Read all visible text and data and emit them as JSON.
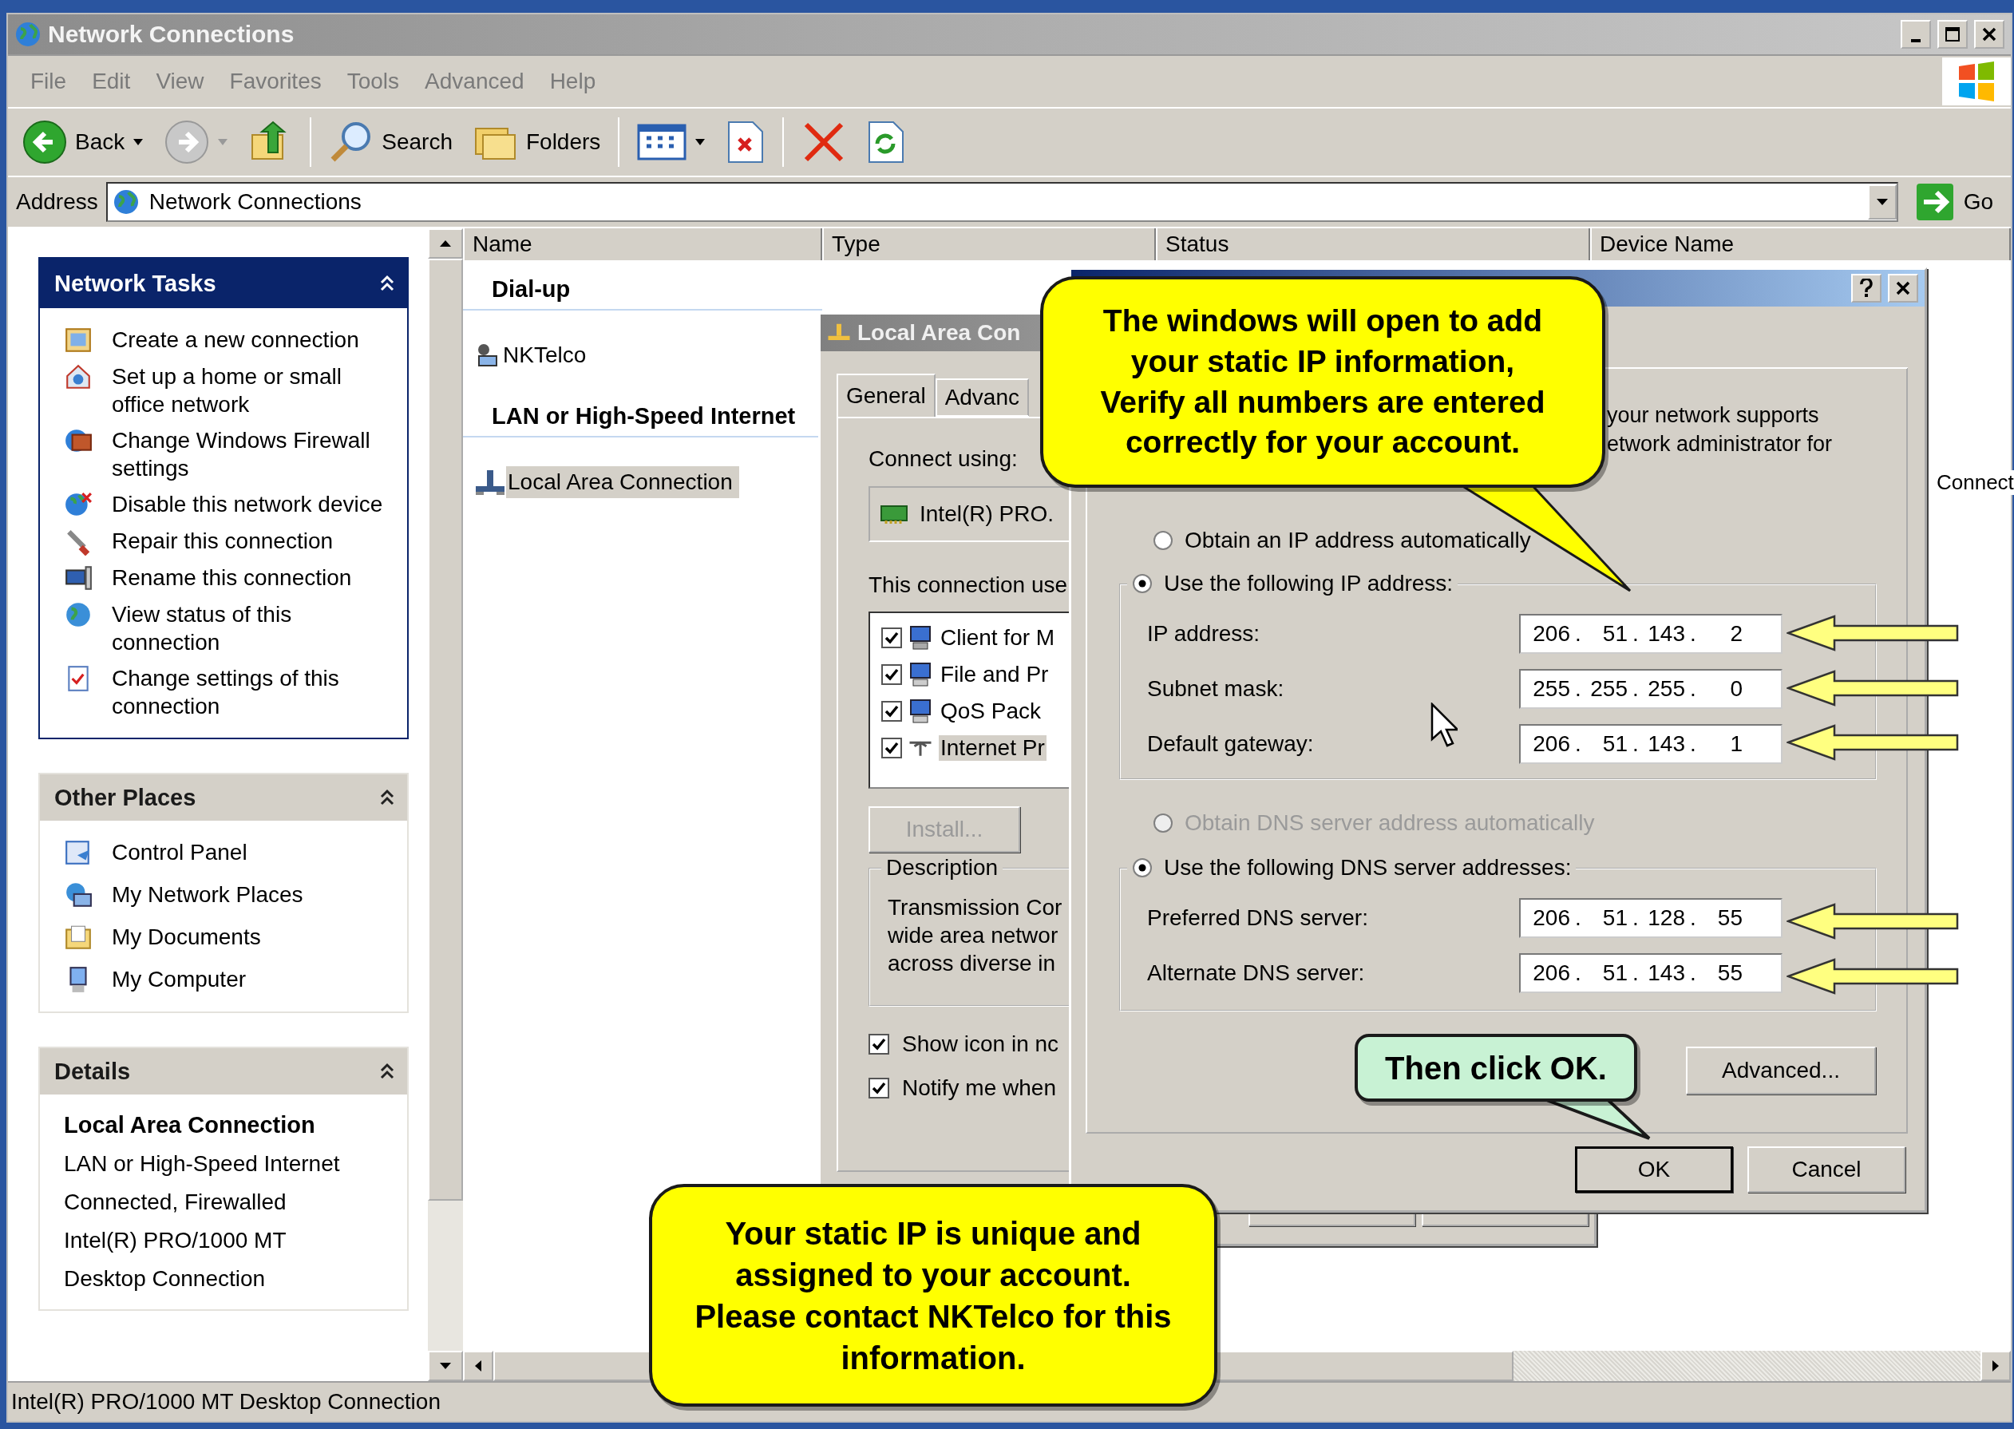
{
  "window": {
    "title": "Network Connections"
  },
  "menu": [
    "File",
    "Edit",
    "View",
    "Favorites",
    "Tools",
    "Advanced",
    "Help"
  ],
  "toolbar": {
    "back": "Back",
    "search": "Search",
    "folders": "Folders"
  },
  "address": {
    "label": "Address",
    "value": "Network Connections",
    "go": "Go"
  },
  "task_pane": [
    {
      "title": "Network Tasks",
      "kind": "primary",
      "items": [
        "Create a new connection",
        "Set up a home or small office network",
        "Change Windows Firewall settings",
        "Disable this network device",
        "Repair this connection",
        "Rename this connection",
        "View status of this connection",
        "Change settings of this connection"
      ]
    },
    {
      "title": "Other Places",
      "kind": "places",
      "items": [
        "Control Panel",
        "My Network Places",
        "My Documents",
        "My Computer"
      ]
    },
    {
      "title": "Details",
      "kind": "details",
      "heading": "Local Area Connection",
      "lines": [
        "LAN or High-Speed Internet",
        "Connected, Firewalled",
        "Intel(R) PRO/1000 MT",
        "Desktop Connection"
      ]
    }
  ],
  "list": {
    "columns": [
      "Name",
      "Type",
      "Status",
      "Device Name"
    ],
    "groups": [
      {
        "title": "Dial-up",
        "items": [
          {
            "kind": "dialup",
            "name": "NKTelco",
            "selected": false
          }
        ]
      },
      {
        "title": "LAN or High-Speed Internet",
        "items": [
          {
            "kind": "lan",
            "name": "Local Area Connection",
            "selected": true,
            "device_name": "Connect"
          }
        ]
      }
    ]
  },
  "status_bar": "Intel(R) PRO/1000 MT Desktop Connection",
  "properties_dialog": {
    "title": "Local Area Con",
    "tabs": [
      {
        "label": "General",
        "selected": true
      },
      {
        "label": "Advanc",
        "selected": false
      }
    ],
    "connect_using": "Connect using:",
    "adapter": "Intel(R) PRO.",
    "components_label": "This connection use",
    "components": [
      {
        "kind": "client",
        "label": "Client for M",
        "checked": true,
        "selected": false
      },
      {
        "kind": "service",
        "label": "File and Pr",
        "checked": true,
        "selected": false
      },
      {
        "kind": "service",
        "label": "QoS Pack",
        "checked": true,
        "selected": false
      },
      {
        "kind": "protocol",
        "label": "Internet Pr",
        "checked": true,
        "selected": true
      }
    ],
    "install": {
      "label": "Install...",
      "disabled": true
    },
    "description": {
      "title": "Description",
      "lines": [
        "Transmission Cor",
        "wide area networ",
        "across diverse in"
      ]
    },
    "options": [
      {
        "label": "Show icon in nc",
        "checked": true
      },
      {
        "label": "Notify me when",
        "checked": true
      }
    ]
  },
  "tcpip_dialog": {
    "intro": [
      "your network supports",
      "etwork administrator for"
    ],
    "ip_mode": [
      {
        "label": "Obtain an IP address automatically",
        "selected": false,
        "disabled": false
      },
      {
        "label": "Use the following IP address:",
        "selected": true,
        "disabled": false
      }
    ],
    "ip_fields": [
      {
        "label": "IP address:",
        "octets": [
          "206",
          "51",
          "143",
          "2"
        ],
        "separators": [
          ".",
          ".",
          "."
        ]
      },
      {
        "label": "Subnet mask:",
        "octets": [
          "255",
          "255",
          "255",
          "0"
        ],
        "separators": [
          ".",
          ".",
          "."
        ]
      },
      {
        "label": "Default gateway:",
        "octets": [
          "206",
          "51",
          "143",
          "1"
        ],
        "separators": [
          ".",
          ".",
          "."
        ]
      }
    ],
    "dns_mode": [
      {
        "label": "Obtain DNS server address automatically",
        "selected": false,
        "disabled": true
      },
      {
        "label": "Use the following DNS server addresses:",
        "selected": true,
        "disabled": false
      }
    ],
    "dns_fields": [
      {
        "label": "Preferred DNS server:",
        "octets": [
          "206",
          "51",
          "128",
          "55"
        ],
        "separators": [
          ".",
          ".",
          "."
        ]
      },
      {
        "label": "Alternate DNS server:",
        "octets": [
          "206",
          "51",
          "143",
          "55"
        ],
        "separators": [
          ".",
          ".",
          "."
        ]
      }
    ],
    "advanced": "Advanced...",
    "ok": "OK",
    "cancel": "Cancel"
  },
  "callouts": [
    {
      "text": "The windows will open to add\nyour static IP information,\nVerify all numbers are entered\ncorrectly for your account.",
      "color": "#ffff00"
    },
    {
      "text": "Then click OK.",
      "color": "#c8f2d4"
    },
    {
      "text": "Your static IP is unique and\nassigned to your account.\nPlease contact NKTelco for this\ninformation.",
      "color": "#ffff00"
    }
  ]
}
